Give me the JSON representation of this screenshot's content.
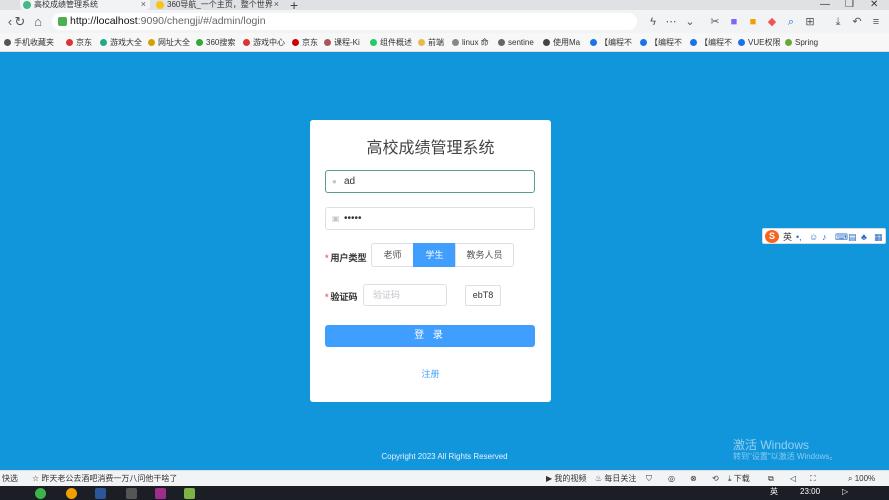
{
  "browser": {
    "tabs": [
      {
        "title": "高校成绩管理系统",
        "active": true
      },
      {
        "title": "360导航_一个主页，整个世界",
        "active": false
      }
    ],
    "url_host": "http://localhost",
    "url_path": ":9090/chengji/#/admin/login",
    "bookmarks": [
      "手机收藏夹",
      "京东",
      "游戏大全",
      "网址大全",
      "360搜索",
      "游戏中心",
      "京东",
      "课程-Ki",
      "组件概述",
      "前端",
      "linux 命",
      "sentine",
      "使用Ma",
      "【编程不",
      "【编程不",
      "【编程不",
      "VUE权限",
      "Spring"
    ]
  },
  "login": {
    "title": "高校成绩管理系统",
    "username_value": "ad",
    "password_value": "•••••",
    "user_type_label": "用户类型",
    "user_types": [
      "老师",
      "学生",
      "教务人员"
    ],
    "selected_user_type": "学生",
    "captcha_label": "验证码",
    "captcha_placeholder": "验证码",
    "captcha_code": "ebT8",
    "login_button": "登 录",
    "register_link": "注册"
  },
  "footer": {
    "copyright": "Copyright 2023 All Rights Reserved"
  },
  "watermark": {
    "line1": "激活 Windows",
    "line2": "转到\"设置\"以激活 Windows。"
  },
  "ime_bar": {
    "lang": "英"
  },
  "statusbar": {
    "left_text": "快选",
    "news": "昨天老公去酒吧消费一万八问他干啥了",
    "my_video": "我的视频",
    "daily_focus": "每日关注",
    "download": "下载",
    "zoom": "100%"
  },
  "taskbar": {
    "time": "23:00",
    "lang": "英"
  },
  "colors": {
    "page_bg": "#1296db",
    "primary": "#409eff",
    "required": "#f56c6c"
  }
}
